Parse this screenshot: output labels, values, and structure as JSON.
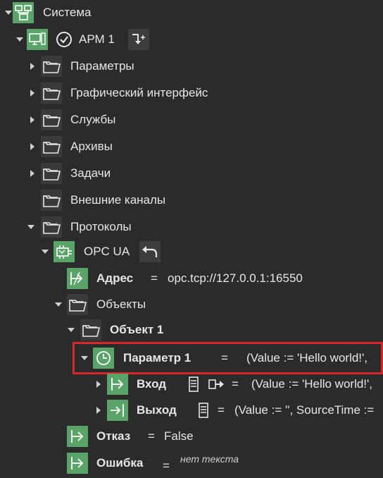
{
  "tree": {
    "system": {
      "label": "Система"
    },
    "arm": {
      "label": "АРМ 1"
    },
    "folders": [
      {
        "label": "Параметры"
      },
      {
        "label": "Графический интерфейс"
      },
      {
        "label": "Службы"
      },
      {
        "label": "Архивы"
      },
      {
        "label": "Задачи"
      },
      {
        "label": "Внешние каналы"
      },
      {
        "label": "Протоколы"
      }
    ],
    "opcua": {
      "label": "OPC UA"
    },
    "address": {
      "label": "Адрес",
      "eq": "=",
      "value": "opc.tcp://127.0.0.1:16550"
    },
    "objects": {
      "label": "Объекты"
    },
    "object1": {
      "label": "Объект 1"
    },
    "param1": {
      "label": "Параметр 1",
      "eq": "=",
      "value": "(Value := 'Hello world!',"
    },
    "input": {
      "label": "Вход",
      "eq": "=",
      "value": "(Value := 'Hello world!',"
    },
    "output": {
      "label": "Выход",
      "eq": "=",
      "value": "(Value := '', SourceTime :="
    },
    "fail": {
      "label": "Отказ",
      "eq": "=",
      "value": "False"
    },
    "error": {
      "label": "Ошибка",
      "eq": "=",
      "value": "нет текста"
    }
  },
  "colors": {
    "background": "#2b2b2b",
    "icon_green": "#5aa469",
    "highlight": "#d9262b"
  }
}
